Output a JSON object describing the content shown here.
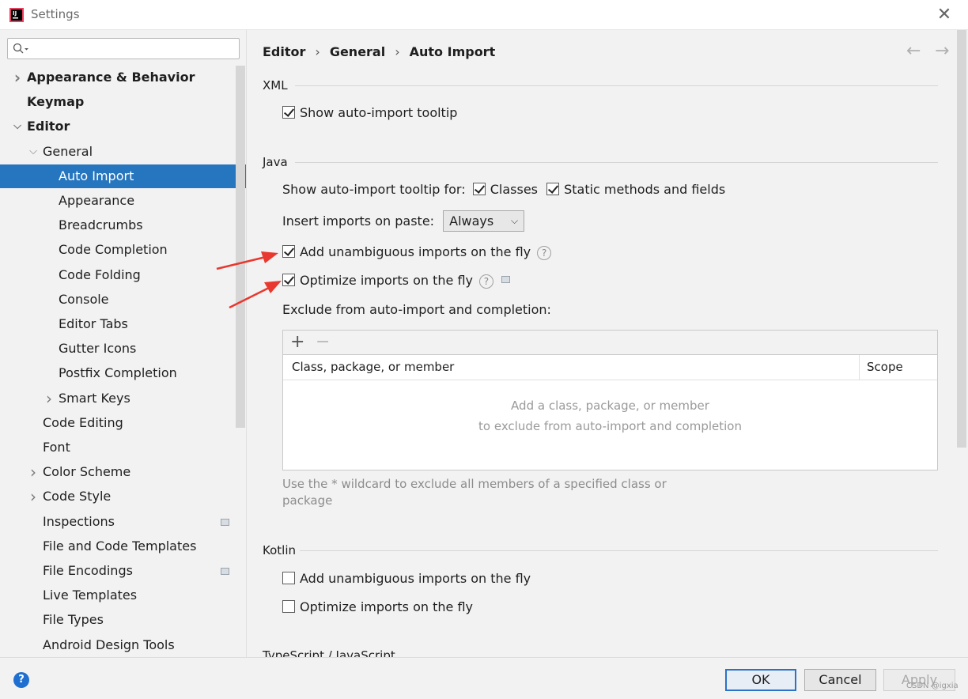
{
  "window": {
    "title": "Settings"
  },
  "sidebar": {
    "search_placeholder": "",
    "items": [
      {
        "label": "Appearance & Behavior",
        "level": 0,
        "chevron": "right",
        "bold": true
      },
      {
        "label": "Keymap",
        "level": 0,
        "chevron": "",
        "bold": true
      },
      {
        "label": "Editor",
        "level": 0,
        "chevron": "down",
        "bold": true
      },
      {
        "label": "General",
        "level": 1,
        "chevron": "down",
        "bold": false
      },
      {
        "label": "Auto Import",
        "level": 2,
        "chevron": "",
        "bold": false,
        "selected": true
      },
      {
        "label": "Appearance",
        "level": 2,
        "chevron": "",
        "bold": false
      },
      {
        "label": "Breadcrumbs",
        "level": 2,
        "chevron": "",
        "bold": false
      },
      {
        "label": "Code Completion",
        "level": 2,
        "chevron": "",
        "bold": false
      },
      {
        "label": "Code Folding",
        "level": 2,
        "chevron": "",
        "bold": false
      },
      {
        "label": "Console",
        "level": 2,
        "chevron": "",
        "bold": false
      },
      {
        "label": "Editor Tabs",
        "level": 2,
        "chevron": "",
        "bold": false
      },
      {
        "label": "Gutter Icons",
        "level": 2,
        "chevron": "",
        "bold": false
      },
      {
        "label": "Postfix Completion",
        "level": 2,
        "chevron": "",
        "bold": false
      },
      {
        "label": "Smart Keys",
        "level": 2,
        "chevron": "right",
        "bold": false
      },
      {
        "label": "Code Editing",
        "level": 1,
        "chevron": "",
        "bold": false
      },
      {
        "label": "Font",
        "level": 1,
        "chevron": "",
        "bold": false
      },
      {
        "label": "Color Scheme",
        "level": 1,
        "chevron": "right",
        "bold": false
      },
      {
        "label": "Code Style",
        "level": 1,
        "chevron": "right",
        "bold": false
      },
      {
        "label": "Inspections",
        "level": 1,
        "chevron": "",
        "bold": false,
        "badge": true
      },
      {
        "label": "File and Code Templates",
        "level": 1,
        "chevron": "",
        "bold": false
      },
      {
        "label": "File Encodings",
        "level": 1,
        "chevron": "",
        "bold": false,
        "badge": true
      },
      {
        "label": "Live Templates",
        "level": 1,
        "chevron": "",
        "bold": false
      },
      {
        "label": "File Types",
        "level": 1,
        "chevron": "",
        "bold": false
      },
      {
        "label": "Android Design Tools",
        "level": 1,
        "chevron": "",
        "bold": false
      }
    ]
  },
  "breadcrumb": {
    "editor": "Editor",
    "general": "General",
    "current": "Auto Import",
    "separator": "›"
  },
  "xml": {
    "title": "XML",
    "show_tooltip": {
      "label": "Show auto-import tooltip",
      "checked": true
    }
  },
  "java": {
    "title": "Java",
    "tooltip_for_label": "Show auto-import tooltip for:",
    "classes": {
      "label": "Classes",
      "checked": true
    },
    "static_members": {
      "label": "Static methods and fields",
      "checked": true
    },
    "paste_label": "Insert imports on paste:",
    "paste_value": "Always",
    "add_unambiguous": {
      "label": "Add unambiguous imports on the fly",
      "checked": true
    },
    "optimize": {
      "label": "Optimize imports on the fly",
      "checked": true
    },
    "exclude_label": "Exclude from auto-import and completion:",
    "table": {
      "add": "+",
      "remove": "−",
      "col1": "Class, package, or member",
      "col2": "Scope",
      "empty_line1": "Add a class, package, or member",
      "empty_line2": "to exclude from auto-import and completion"
    },
    "hint": "Use the * wildcard to exclude all members of a specified class or package"
  },
  "kotlin": {
    "title": "Kotlin",
    "add_unambiguous": {
      "label": "Add unambiguous imports on the fly",
      "checked": false
    },
    "optimize": {
      "label": "Optimize imports on the fly",
      "checked": false
    }
  },
  "next_section_title": "TypeScript / JavaScript",
  "footer": {
    "help": "?",
    "ok": "OK",
    "cancel": "Cancel",
    "apply": "Apply"
  },
  "watermark": "CSDN @igxia",
  "colors": {
    "selection": "#2675bf",
    "annotation_arrow": "#e8382f",
    "primary_border": "#2a73c8"
  }
}
